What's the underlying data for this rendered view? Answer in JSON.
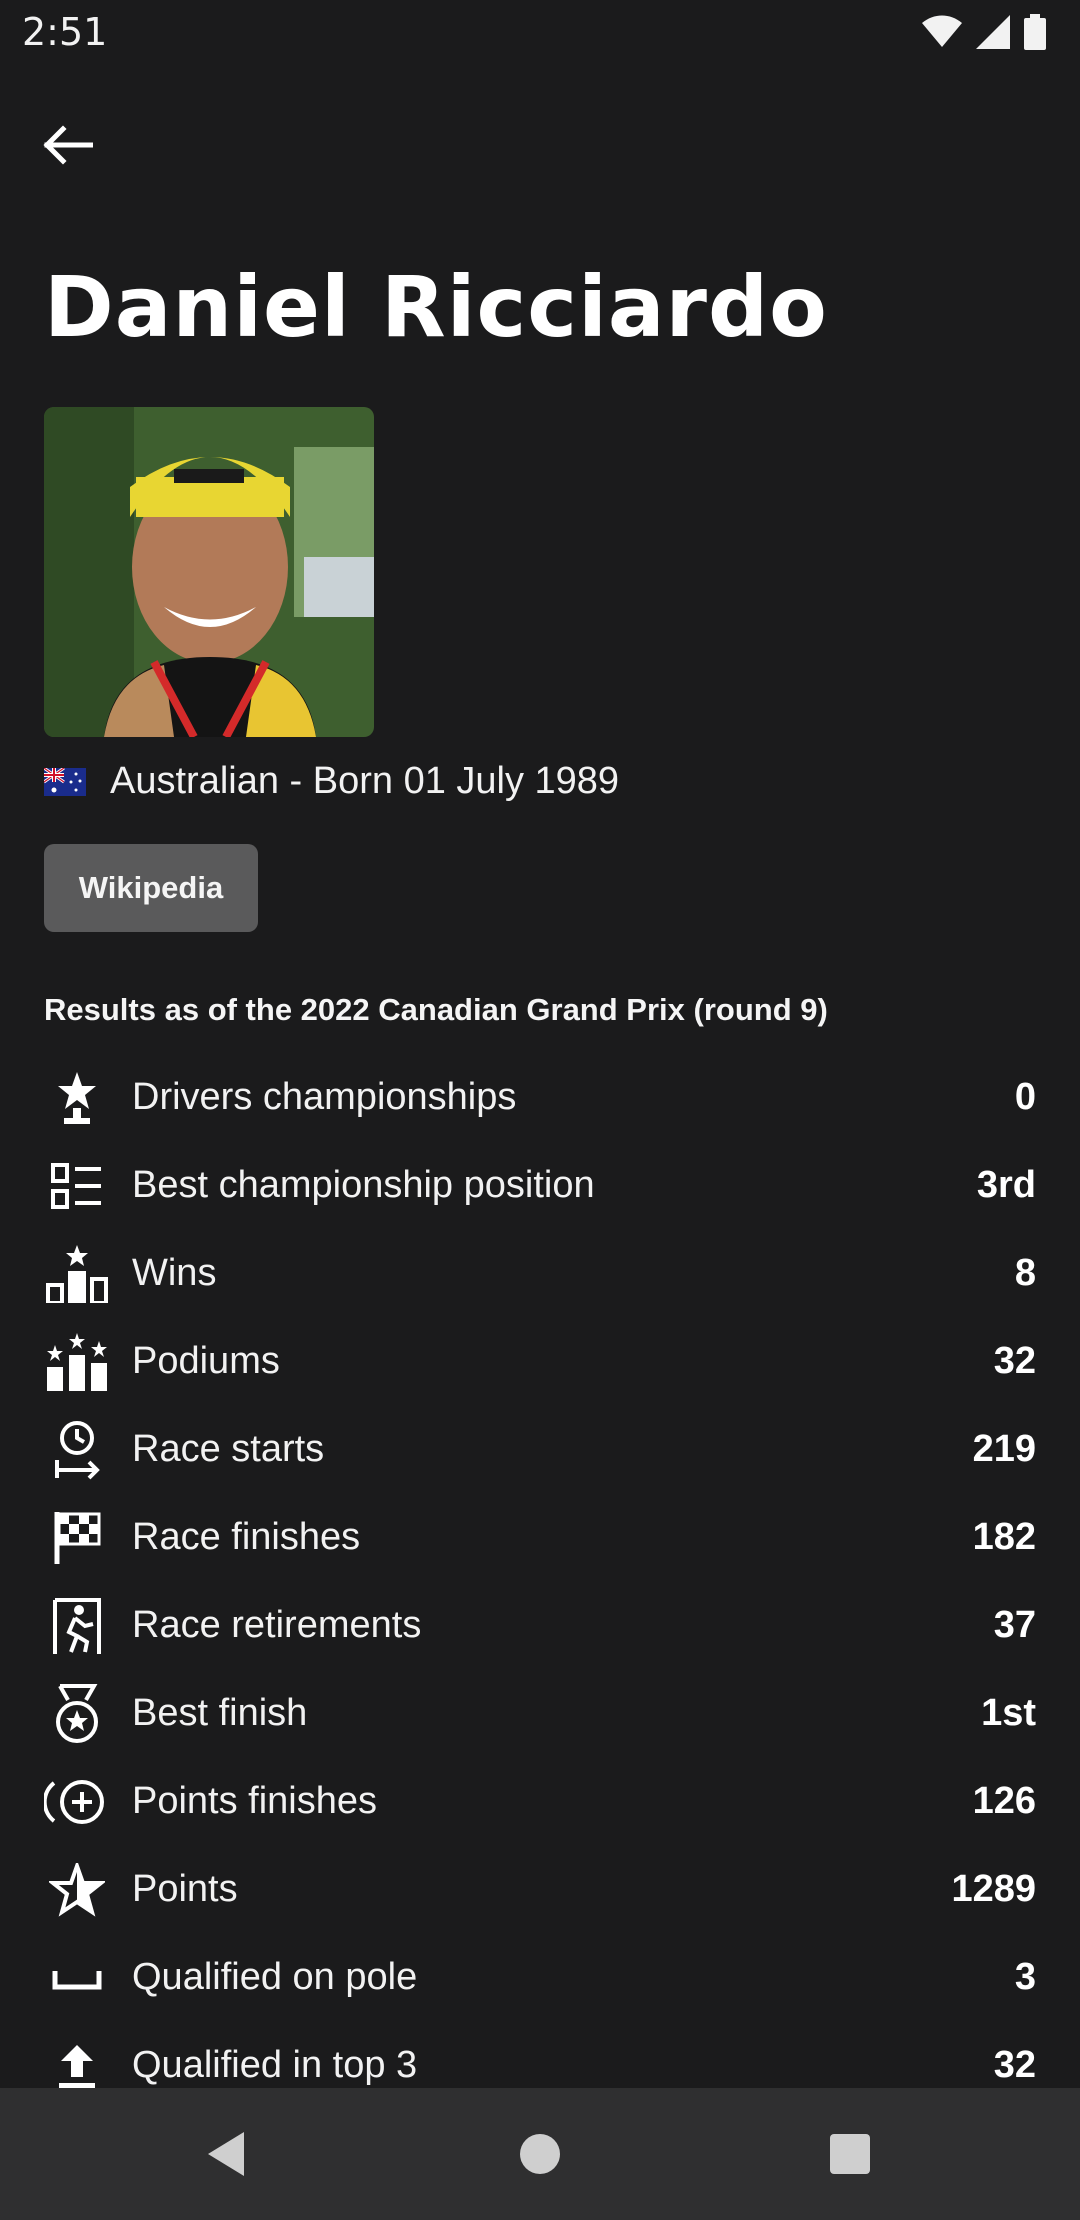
{
  "status_bar": {
    "time": "2:51",
    "icons": [
      "wifi-icon",
      "signal-icon",
      "battery-icon"
    ]
  },
  "header": {
    "back_icon": "arrow-left-icon"
  },
  "driver": {
    "name": "Daniel Ricciardo",
    "photo_alt": "Daniel Ricciardo photo",
    "nationality_line": "Australian - Born 01 July 1989",
    "flag": "australia-flag"
  },
  "actions": {
    "wikipedia_label": "Wikipedia"
  },
  "results_note": "Results as of the 2022 Canadian Grand Prix (round 9)",
  "stats": [
    {
      "icon": "trophy-star-icon",
      "label": "Drivers championships",
      "value": "0"
    },
    {
      "icon": "ranking-list-icon",
      "label": "Best championship position",
      "value": "3rd"
    },
    {
      "icon": "podium-star-icon",
      "label": "Wins",
      "value": "8"
    },
    {
      "icon": "podium-stars-icon",
      "label": "Podiums",
      "value": "32"
    },
    {
      "icon": "timer-start-icon",
      "label": "Race starts",
      "value": "219"
    },
    {
      "icon": "checkered-flag-icon",
      "label": "Race finishes",
      "value": "182"
    },
    {
      "icon": "exit-door-icon",
      "label": "Race retirements",
      "value": "37"
    },
    {
      "icon": "medal-icon",
      "label": "Best finish",
      "value": "1st"
    },
    {
      "icon": "plus-circle-icon",
      "label": "Points finishes",
      "value": "126"
    },
    {
      "icon": "star-outline-icon",
      "label": "Points",
      "value": "1289"
    },
    {
      "icon": "space-bracket-icon",
      "label": "Qualified on pole",
      "value": "3"
    },
    {
      "icon": "upload-arrow-icon",
      "label": "Qualified in top 3",
      "value": "32"
    }
  ],
  "nav_bar": {
    "back": "nav-back-icon",
    "home": "nav-home-icon",
    "recents": "nav-recents-icon"
  },
  "colors": {
    "background": "#1b1b1c",
    "button": "#5a5a5b",
    "nav_bar": "#2f2f30",
    "text": "#ffffff"
  }
}
